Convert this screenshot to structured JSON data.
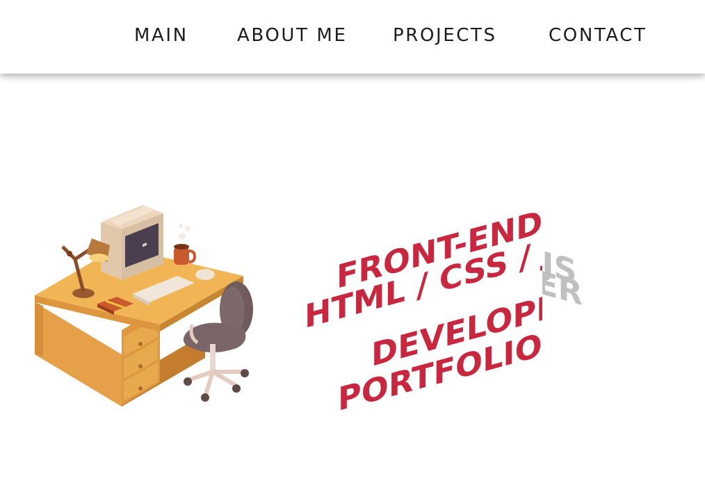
{
  "nav": {
    "items": [
      "MAIN",
      "ABOUT ME",
      "PROJECTS",
      "CONTACT"
    ]
  },
  "hero": {
    "lines": [
      "FRONT-END",
      "HTML / CSS / JS",
      "DEVELOPER",
      "PORTFOLIO"
    ]
  },
  "colors": {
    "accent": "#c8283f",
    "text_fold": "#c0c0c0",
    "nav_text": "#1c1c1c",
    "desk": "#e9a443"
  }
}
